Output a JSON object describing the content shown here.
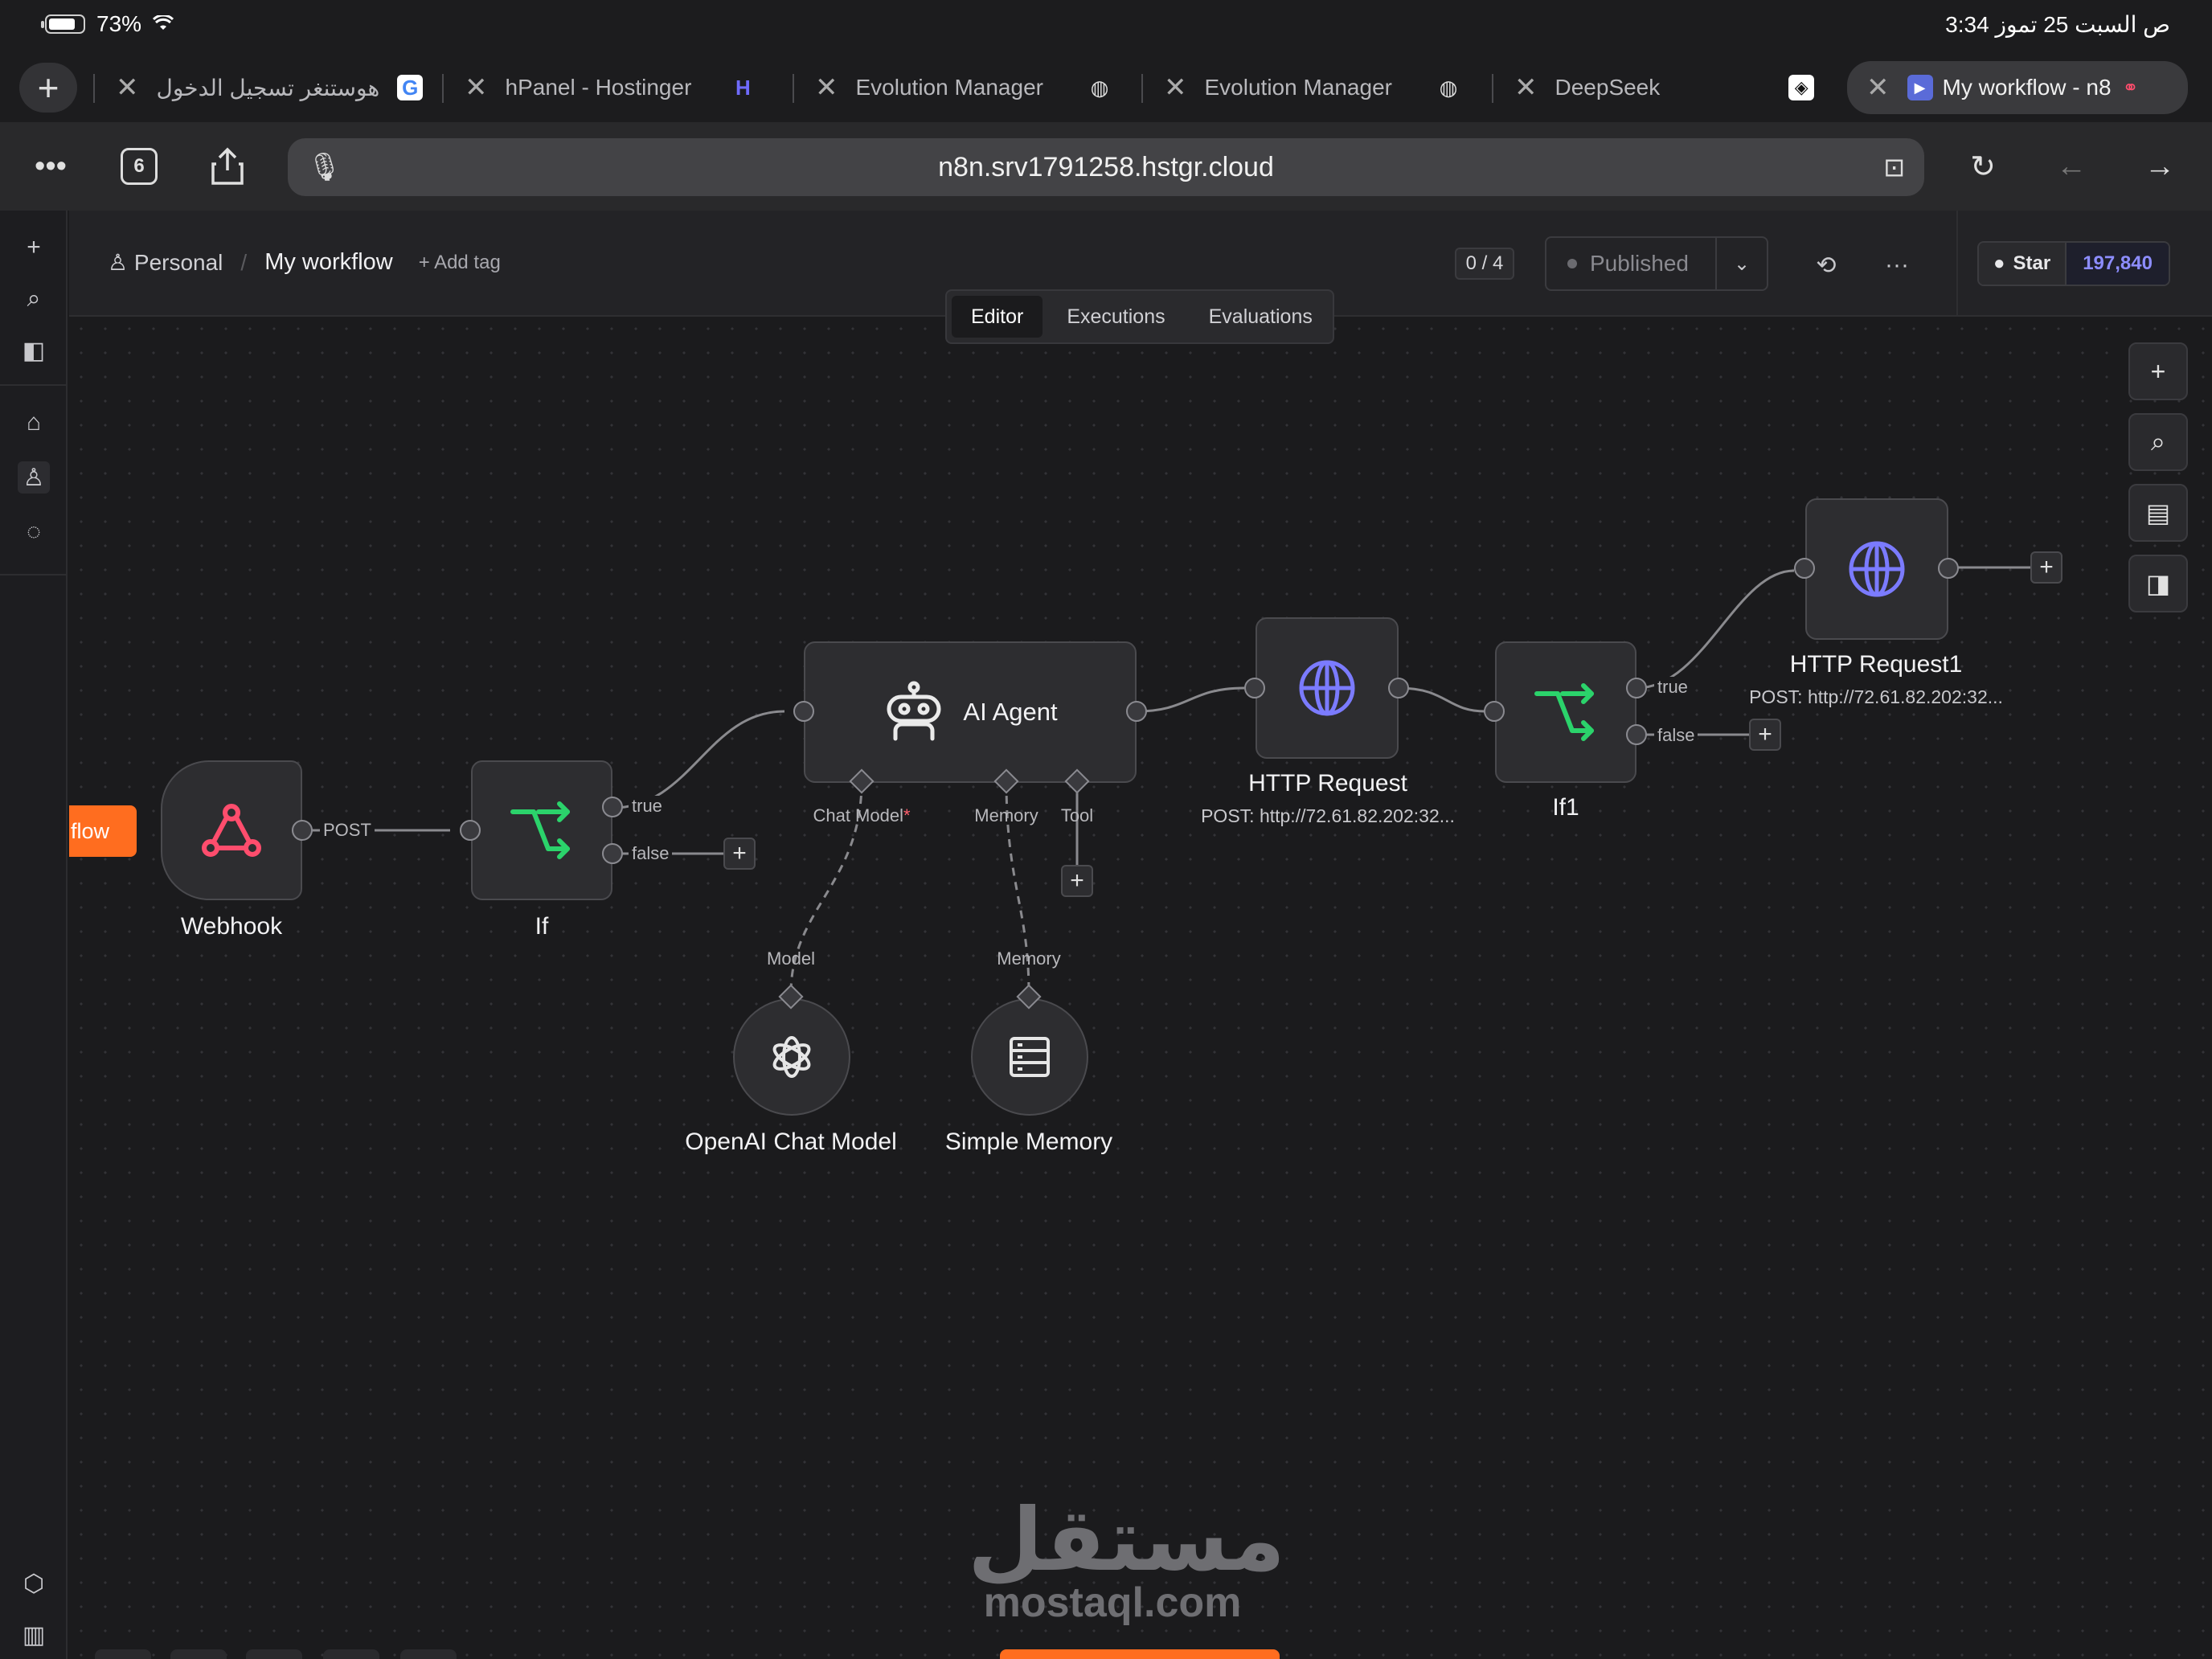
{
  "status_bar": {
    "battery": "73%",
    "clock": "3:34 ص   السبت 25 تموز"
  },
  "browser": {
    "tabs": [
      {
        "title": "هوستنغر تسجيل الدخول",
        "favicon": "google-icon"
      },
      {
        "title": "hPanel - Hostinger",
        "favicon": "hostinger-icon"
      },
      {
        "title": "Evolution Manager",
        "favicon": "globe-icon"
      },
      {
        "title": "Evolution Manager",
        "favicon": "globe-icon"
      },
      {
        "title": "DeepSeek",
        "favicon": "deepseek-icon"
      },
      {
        "title": "My workflow - n8",
        "favicon": "n8n-icon",
        "active": true
      }
    ],
    "tabs_count": "6",
    "url": "n8n.srv1791258.hstgr.cloud"
  },
  "header": {
    "project": "Personal",
    "workflow_name": "My workflow",
    "add_tag": "+ Add tag",
    "count": "0 / 4",
    "publish_status": "Published",
    "github_star_label": "Star",
    "github_star_count": "197,840"
  },
  "view_tabs": [
    "Editor",
    "Executions",
    "Evaluations"
  ],
  "canvas": {
    "nodes": {
      "webhook": "Webhook",
      "if": "If",
      "agent": "AI Agent",
      "http1": "HTTP Request",
      "http1_sub": "POST: http://72.61.82.202:32...",
      "if1": "If1",
      "http2": "HTTP Request1",
      "http2_sub": "POST: http://72.61.82.202:32...",
      "openai": "OpenAI Chat Model",
      "memory": "Simple Memory"
    },
    "edge_labels": {
      "post": "POST",
      "true": "true",
      "false": "false",
      "chat_model": "Chat Model",
      "chat_model_required": "*",
      "memory": "Memory",
      "tool": "Tool",
      "model": "Model"
    },
    "orange_pill": "flow"
  },
  "watermark": {
    "arabic": "مستقل",
    "latin": "mostaql.com"
  },
  "colors": {
    "accent_orange": "#ff6d1f",
    "webhook_pink": "#ff4d6d",
    "if_green": "#2bd36b",
    "http_blue": "#7b7bff",
    "star_count": "#8d8dff"
  }
}
